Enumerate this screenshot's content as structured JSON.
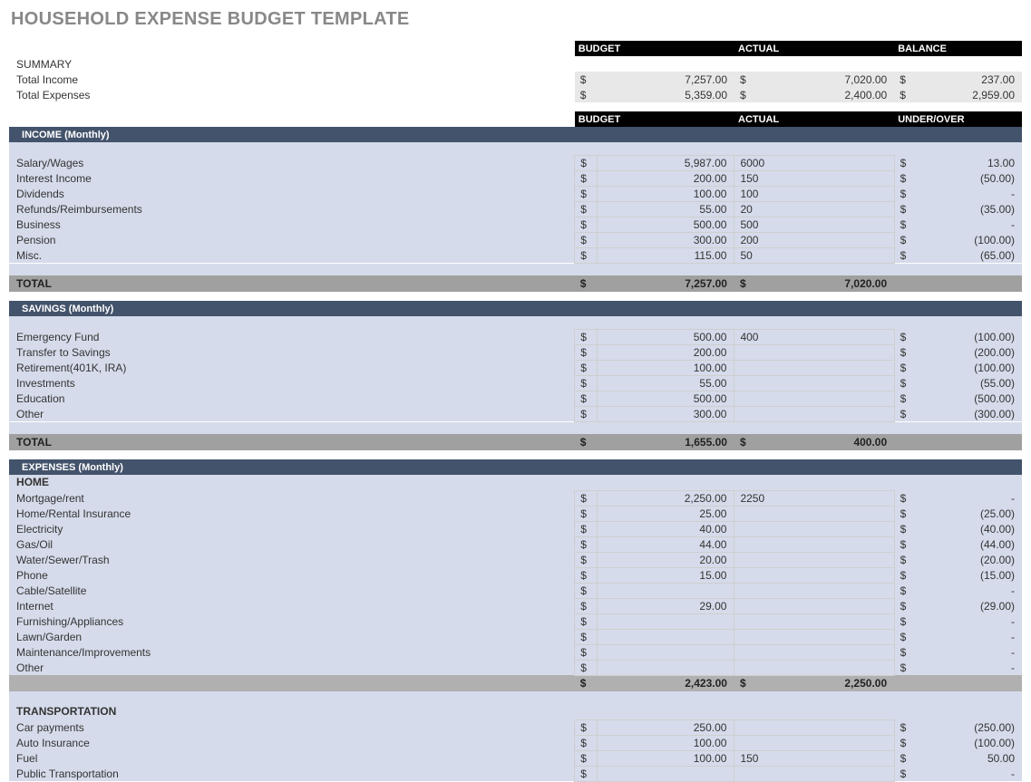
{
  "title": "HOUSEHOLD EXPENSE BUDGET TEMPLATE",
  "summary": {
    "label": "SUMMARY",
    "headers": {
      "budget": "BUDGET",
      "actual": "ACTUAL",
      "balance": "BALANCE"
    },
    "rows": [
      {
        "label": "Total Income",
        "budget": "7,257.00",
        "actual": "7,020.00",
        "balance": "237.00"
      },
      {
        "label": "Total Expenses",
        "budget": "5,359.00",
        "actual": "2,400.00",
        "balance": "2,959.00"
      }
    ]
  },
  "section_headers": {
    "budget": "BUDGET",
    "actual": "ACTUAL",
    "under_over": "UNDER/OVER"
  },
  "income": {
    "title": "INCOME (Monthly)",
    "rows": [
      {
        "label": "Salary/Wages",
        "budget": "5,987.00",
        "actual": "6000",
        "uo": "13.00"
      },
      {
        "label": "Interest Income",
        "budget": "200.00",
        "actual": "150",
        "uo": "(50.00)"
      },
      {
        "label": "Dividends",
        "budget": "100.00",
        "actual": "100",
        "uo": "-"
      },
      {
        "label": "Refunds/Reimbursements",
        "budget": "55.00",
        "actual": "20",
        "uo": "(35.00)"
      },
      {
        "label": "Business",
        "budget": "500.00",
        "actual": "500",
        "uo": "-"
      },
      {
        "label": "Pension",
        "budget": "300.00",
        "actual": "200",
        "uo": "(100.00)"
      },
      {
        "label": "Misc.",
        "budget": "115.00",
        "actual": "50",
        "uo": "(65.00)"
      }
    ],
    "total": {
      "label": "TOTAL",
      "budget": "7,257.00",
      "actual": "7,020.00"
    }
  },
  "savings": {
    "title": "SAVINGS (Monthly)",
    "rows": [
      {
        "label": "Emergency Fund",
        "budget": "500.00",
        "actual": "400",
        "uo": "(100.00)"
      },
      {
        "label": "Transfer to Savings",
        "budget": "200.00",
        "actual": "",
        "uo": "(200.00)"
      },
      {
        "label": "Retirement(401K, IRA)",
        "budget": "100.00",
        "actual": "",
        "uo": "(100.00)"
      },
      {
        "label": "Investments",
        "budget": "55.00",
        "actual": "",
        "uo": "(55.00)"
      },
      {
        "label": "Education",
        "budget": "500.00",
        "actual": "",
        "uo": "(500.00)"
      },
      {
        "label": "Other",
        "budget": "300.00",
        "actual": "",
        "uo": "(300.00)"
      }
    ],
    "total": {
      "label": "TOTAL",
      "budget": "1,655.00",
      "actual": "400.00"
    }
  },
  "expenses": {
    "title": "EXPENSES (Monthly)",
    "categories": [
      {
        "name": "HOME",
        "rows": [
          {
            "label": "Mortgage/rent",
            "budget": "2,250.00",
            "actual": "2250",
            "uo": "-"
          },
          {
            "label": "Home/Rental Insurance",
            "budget": "25.00",
            "actual": "",
            "uo": "(25.00)"
          },
          {
            "label": "Electricity",
            "budget": "40.00",
            "actual": "",
            "uo": "(40.00)"
          },
          {
            "label": "Gas/Oil",
            "budget": "44.00",
            "actual": "",
            "uo": "(44.00)"
          },
          {
            "label": "Water/Sewer/Trash",
            "budget": "20.00",
            "actual": "",
            "uo": "(20.00)"
          },
          {
            "label": "Phone",
            "budget": "15.00",
            "actual": "",
            "uo": "(15.00)"
          },
          {
            "label": "Cable/Satellite",
            "budget": "",
            "actual": "",
            "uo": "-"
          },
          {
            "label": "Internet",
            "budget": "29.00",
            "actual": "",
            "uo": "(29.00)"
          },
          {
            "label": "Furnishing/Appliances",
            "budget": "",
            "actual": "",
            "uo": "-"
          },
          {
            "label": "Lawn/Garden",
            "budget": "",
            "actual": "",
            "uo": "-"
          },
          {
            "label": "Maintenance/Improvements",
            "budget": "",
            "actual": "",
            "uo": "-"
          },
          {
            "label": "Other",
            "budget": "",
            "actual": "",
            "uo": "-"
          }
        ],
        "subtotal": {
          "budget": "2,423.00",
          "actual": "2,250.00"
        }
      },
      {
        "name": "TRANSPORTATION",
        "rows": [
          {
            "label": "Car payments",
            "budget": "250.00",
            "actual": "",
            "uo": "(250.00)"
          },
          {
            "label": "Auto Insurance",
            "budget": "100.00",
            "actual": "",
            "uo": "(100.00)"
          },
          {
            "label": "Fuel",
            "budget": "100.00",
            "actual": "150",
            "uo": "50.00"
          },
          {
            "label": "Public Transportation",
            "budget": "",
            "actual": "",
            "uo": "-"
          }
        ]
      }
    ]
  },
  "sym": "$"
}
